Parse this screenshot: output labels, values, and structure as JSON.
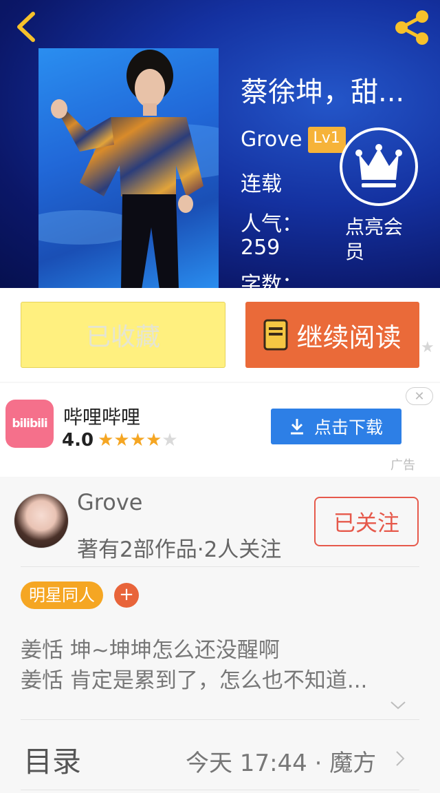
{
  "header": {
    "title": "蔡徐坤，甜...",
    "author": "Grove",
    "level": "Lv1",
    "status": "连载",
    "popularity_label": "人气：",
    "popularity_value": "259",
    "words_label": "字数：",
    "vip_label": "点亮会员"
  },
  "actions": {
    "collected_label": "已收藏",
    "read_label": "继续阅读"
  },
  "ad": {
    "app_icon_text": "bilibili",
    "app_name": "哔哩哔哩",
    "rating": "4.0",
    "rating_value": 4,
    "download_label": "点击下载",
    "close_glyph": "✕",
    "ad_label": "广告"
  },
  "author_card": {
    "name": "Grove",
    "stats": "著有2部作品·2人关注",
    "follow_label": "已关注",
    "tag": "明星同人",
    "tag_add": "+",
    "description": [
      "姜恬 坤~坤坤怎么还没醒啊",
      "姜恬 肯定是累到了，怎么也不知道..."
    ]
  },
  "toc": {
    "label": "目录",
    "update": "今天 17:44 · 魔方"
  },
  "colors": {
    "header_bg": "#1431a0",
    "collected_bg": "#fff07f",
    "read_bg": "#ea6a39",
    "download_bg": "#2d7fe6",
    "follow_accent": "#e6594b",
    "tag_bg": "#f5a623",
    "level_badge": "#f6b339"
  },
  "icons": [
    "back-icon",
    "share-icon",
    "crown-icon",
    "book-icon",
    "download-icon",
    "star-icon",
    "close-icon",
    "chevron-down-icon",
    "chevron-right-icon"
  ]
}
